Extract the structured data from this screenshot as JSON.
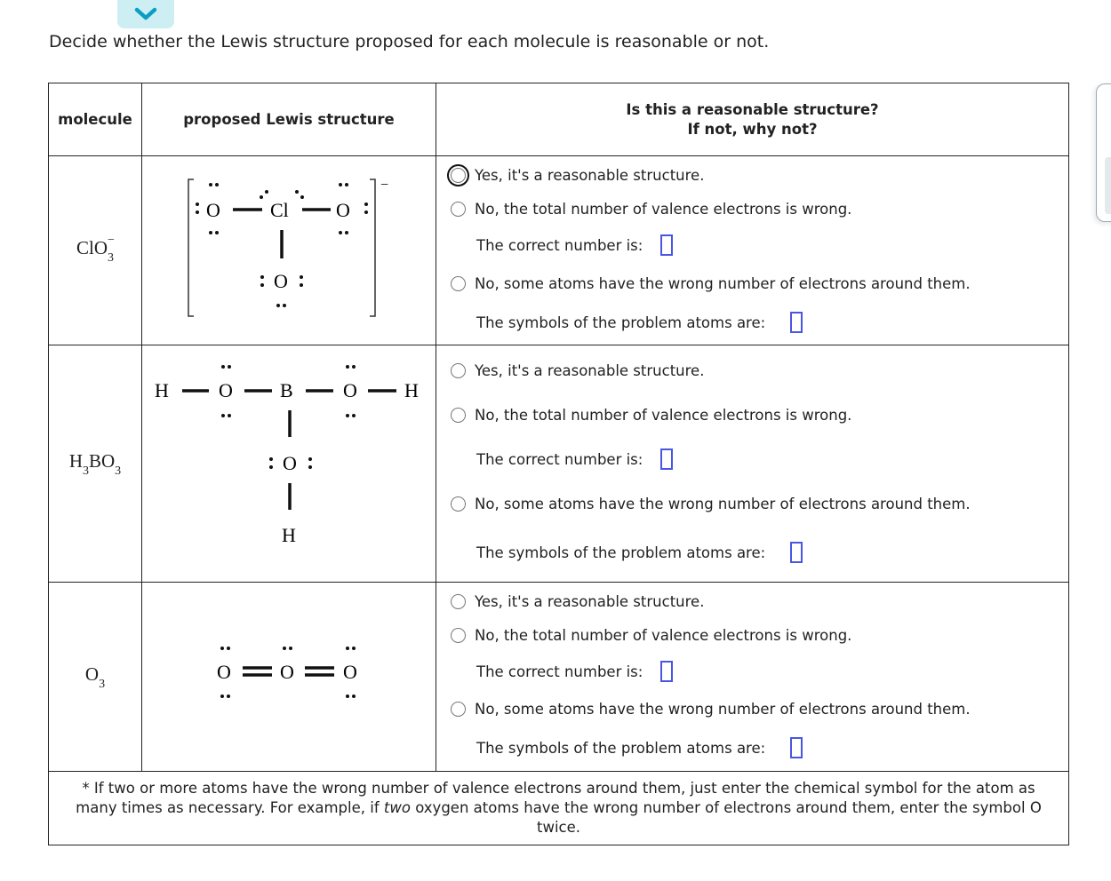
{
  "collapse_icon": "chevron-down-icon",
  "prompt": "Decide whether the Lewis structure proposed for each molecule is reasonable or not.",
  "table": {
    "headers": {
      "molecule": "molecule",
      "structure": "proposed Lewis structure",
      "question_line1": "Is this a reasonable structure?",
      "question_line2": "If not, why not?"
    },
    "options": {
      "yes": "Yes, it's a reasonable structure.",
      "no_valence": "No, the total number of valence electrons is wrong.",
      "correct_number": "The correct number is:",
      "no_atoms": "No, some atoms have the wrong number of electrons around them.",
      "problem_atoms": "The symbols of the problem atoms are:"
    },
    "rows": [
      {
        "formula": "ClO",
        "sub": "3",
        "charge": "−",
        "structure_atoms": {
          "center": "Cl",
          "left": "O",
          "right": "O",
          "bottom": "O",
          "charge": "−"
        },
        "correct_number": "",
        "problem_atoms": ""
      },
      {
        "formula_parts": [
          "H",
          "3",
          "BO",
          "3"
        ],
        "structure_atoms": {
          "h_left": "H",
          "o_left": "O",
          "center": "B",
          "o_right": "O",
          "h_right": "H",
          "o_bottom": "O",
          "h_bottom": "H"
        },
        "correct_number": "",
        "problem_atoms": ""
      },
      {
        "formula": "O",
        "sub": "3",
        "structure_atoms": {
          "left": "O",
          "center": "O",
          "right": "O"
        },
        "correct_number": "",
        "problem_atoms": ""
      }
    ],
    "footnote_pre": "* If two or more atoms have the wrong number of valence electrons around them, just enter the chemical symbol for the atom as many times as necessary. For example, if ",
    "footnote_em": "two",
    "footnote_post": " oxygen atoms have the wrong number of electrons around them, enter the symbol O twice."
  }
}
